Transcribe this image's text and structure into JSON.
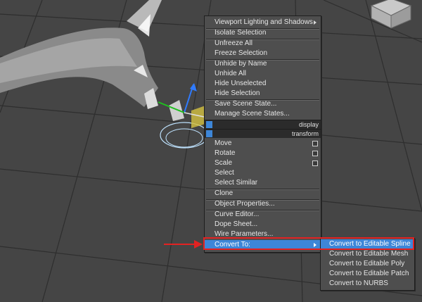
{
  "colors": {
    "viewport_bg": "#454545",
    "grid_line": "#2f2f2f",
    "menu_bg": "#4e4e4e",
    "highlight": "#3d86d8",
    "annotation_red": "#e32222"
  },
  "icons": {
    "viewcube": "viewcube-icon",
    "gizmo": "transform-gizmo-icon",
    "pointer": "red-arrow-icon"
  },
  "quad_menu": {
    "items": {
      "viewport_lighting": "Viewport Lighting and Shadows",
      "isolate_selection": "Isolate Selection",
      "unfreeze_all": "Unfreeze All",
      "freeze_selection": "Freeze Selection",
      "unhide_by_name": "Unhide by Name",
      "unhide_all": "Unhide All",
      "hide_unselected": "Hide Unselected",
      "hide_selection": "Hide Selection",
      "save_scene_state": "Save Scene State...",
      "manage_scene_states": "Manage Scene States...",
      "move": "Move",
      "rotate": "Rotate",
      "scale": "Scale",
      "select": "Select",
      "select_similar": "Select Similar",
      "clone": "Clone",
      "object_properties": "Object Properties...",
      "curve_editor": "Curve Editor...",
      "dope_sheet": "Dope Sheet...",
      "wire_parameters": "Wire Parameters...",
      "convert_to": "Convert To:"
    },
    "headers": {
      "display": "display",
      "transform": "transform"
    }
  },
  "submenu": {
    "items": [
      "Convert to Editable Spline",
      "Convert to Editable Mesh",
      "Convert to Editable Poly",
      "Convert to Editable Patch",
      "Convert to NURBS"
    ]
  }
}
